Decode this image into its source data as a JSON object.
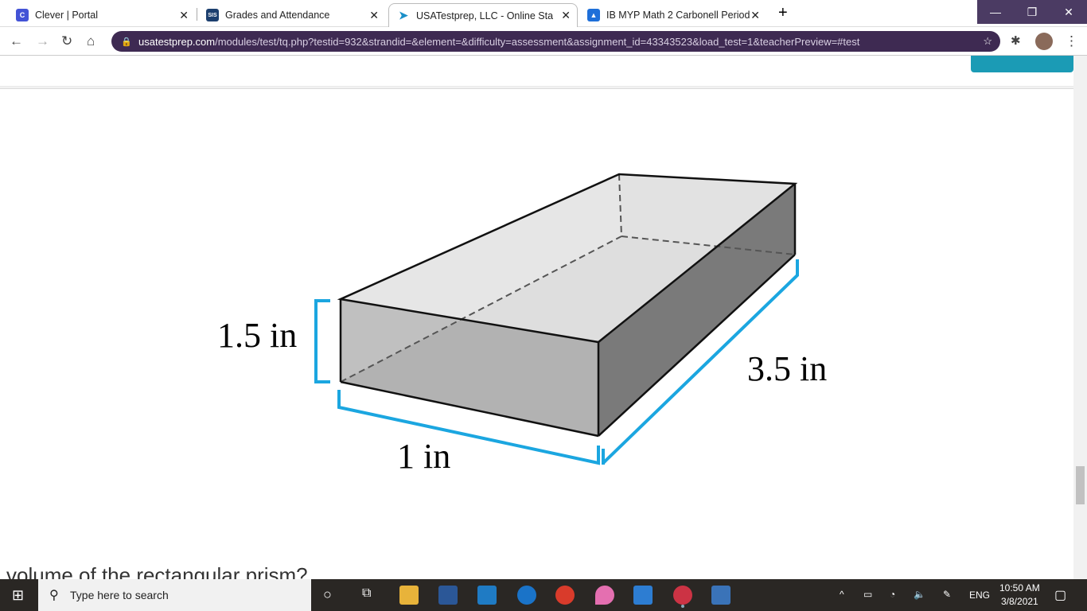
{
  "tabs": [
    {
      "title": "Clever | Portal",
      "icon": "C"
    },
    {
      "title": "Grades and Attendance",
      "icon": "SIS"
    },
    {
      "title": "USATestprep, LLC - Online State-",
      "icon": "cursor"
    },
    {
      "title": "IB MYP Math 2 Carbonell Period",
      "icon": "classroom"
    }
  ],
  "url": {
    "domain": "usatestprep.com",
    "path": "/modules/test/tq.php?testid=932&strandid=&element=&difficulty=assessment&assignment_id=43343523&load_test=1&teacherPreview=#test"
  },
  "figure": {
    "height_label": "1.5 in",
    "width_label": "1 in",
    "length_label": "3.5 in"
  },
  "question_partial": "volume of the rectangular prism?",
  "taskbar": {
    "search_placeholder": "Type here to search",
    "lang": "ENG",
    "time": "10:50 AM",
    "date": "3/8/2021"
  },
  "colors": {
    "accent": "#1ba6e0",
    "browser": "#3e2a52"
  }
}
